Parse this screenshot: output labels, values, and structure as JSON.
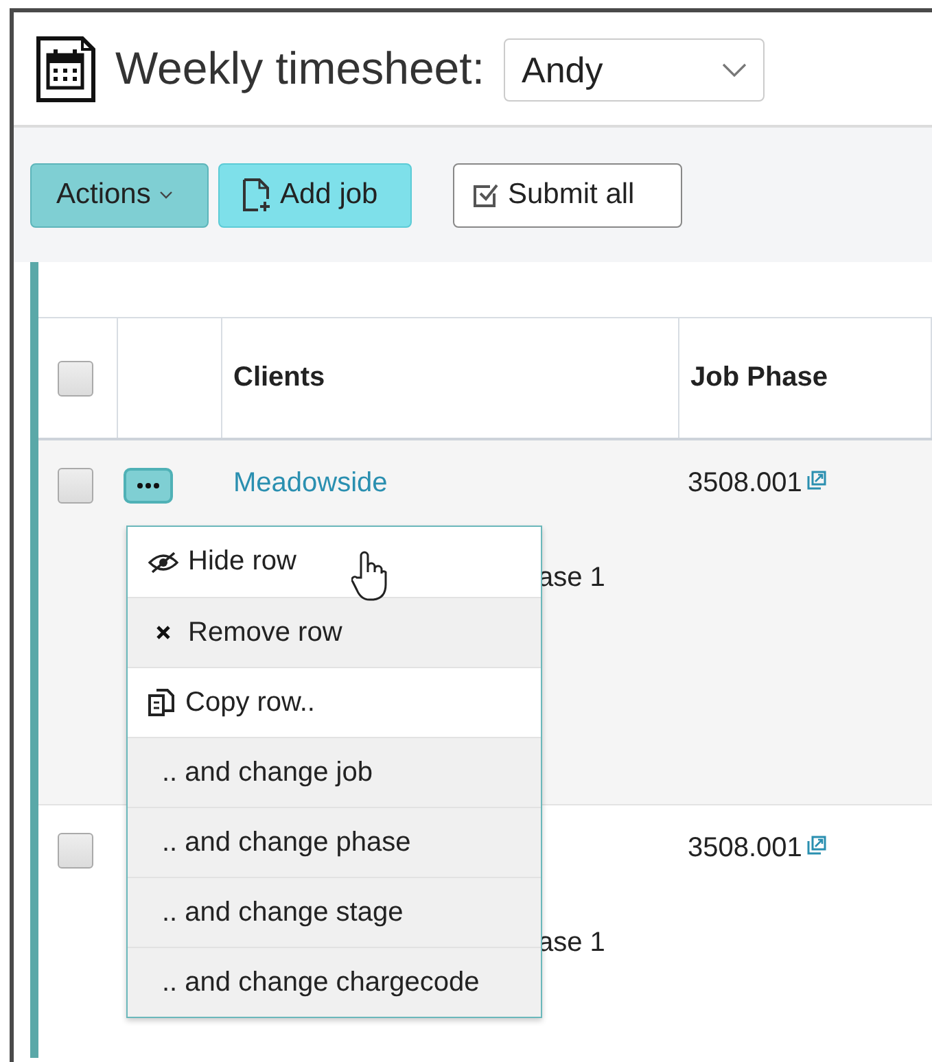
{
  "header": {
    "title": "Weekly timesheet:",
    "person_select": {
      "value": "Andy"
    }
  },
  "toolbar": [
    {
      "kind": "dropdown",
      "label": "Actions"
    },
    {
      "kind": "add",
      "label": "Add job"
    },
    {
      "kind": "submit",
      "label": "Submit all"
    }
  ],
  "table": {
    "header_checkbox": {
      "checked": false
    },
    "columns": [
      "Clients",
      "Job Phase"
    ],
    "rows": [
      {
        "checked": false,
        "client": "Meadowside",
        "client_detail": "ase 1",
        "job_phase": "3508.001",
        "row_menu_button": true
      },
      {
        "checked": false,
        "client_detail": "ase 1",
        "job_phase": "3508.001",
        "row_menu_button": false
      }
    ]
  },
  "row_menu": {
    "items": [
      {
        "kind": "hide",
        "label": "Hide row",
        "shaded": false
      },
      {
        "kind": "remove",
        "label": "Remove row",
        "shaded": true
      },
      {
        "kind": "copy",
        "label": "Copy row..",
        "shaded": false
      },
      {
        "kind": "sub",
        "label": ".. and change job",
        "shaded": true
      },
      {
        "kind": "sub",
        "label": ".. and change phase",
        "shaded": true
      },
      {
        "kind": "sub",
        "label": ".. and change stage",
        "shaded": true
      },
      {
        "kind": "sub",
        "label": ".. and change chargecode",
        "shaded": true
      }
    ]
  }
}
